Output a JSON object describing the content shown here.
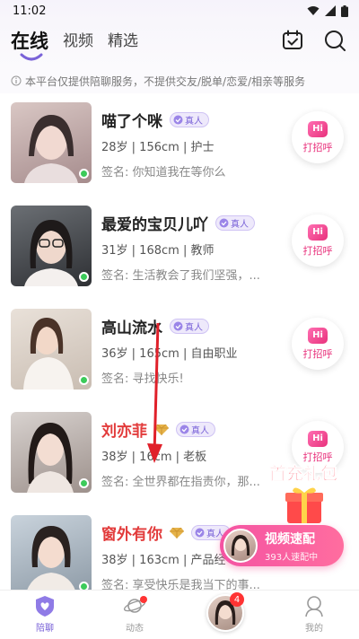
{
  "status_bar": {
    "time": "11:02"
  },
  "header": {
    "tabs": [
      {
        "label": "在线",
        "active": true
      },
      {
        "label": "视频",
        "active": false
      },
      {
        "label": "精选",
        "active": false
      }
    ],
    "icons": [
      "calendar-check-icon",
      "search-icon"
    ],
    "accent_color": "#7a63d8"
  },
  "notice": "本平台仅提供陪聊服务，不提供交友/脱单/恋爱/相亲等服务",
  "users": [
    {
      "name": "喵了个咪",
      "vip": false,
      "real_label": "真人",
      "info": "28岁 | 156cm | 护士",
      "sign": "签名: 你知道我在等你么",
      "online": true
    },
    {
      "name": "最爱的宝贝儿吖",
      "vip": false,
      "real_label": "真人",
      "info": "31岁 | 168cm | 教师",
      "sign": "签名: 生活教会了我们坚强，...",
      "online": true
    },
    {
      "name": "高山流水",
      "vip": false,
      "real_label": "真人",
      "info": "36岁 | 165cm | 自由职业",
      "sign": "签名: 寻找快乐!",
      "online": true
    },
    {
      "name": "刘亦菲",
      "vip": true,
      "real_label": "真人",
      "info": "38岁 | 16cm | 老板",
      "sign": "签名: 全世界都在指责你，那...",
      "online": true
    },
    {
      "name": "窗外有你",
      "vip": true,
      "real_label": "真人",
      "info": "38岁 | 163cm | 产品经",
      "sign": "签名: 享受快乐是我当下的事...",
      "online": true
    }
  ],
  "hi_button": {
    "icon_text": "Hi",
    "label": "打招呼"
  },
  "gift_banner": {
    "title": "首充礼包"
  },
  "match_button": {
    "title": "视频速配",
    "subtitle": "393人速配中"
  },
  "tabbar": [
    {
      "label": "陪聊",
      "active": true,
      "icon": "heart-shield-icon"
    },
    {
      "label": "动态",
      "active": false,
      "icon": "planet-icon",
      "dot": true
    },
    {
      "label": "",
      "active": false,
      "icon": "avatar",
      "badge": "4"
    },
    {
      "label": "我的",
      "active": false,
      "icon": "person-icon"
    }
  ]
}
